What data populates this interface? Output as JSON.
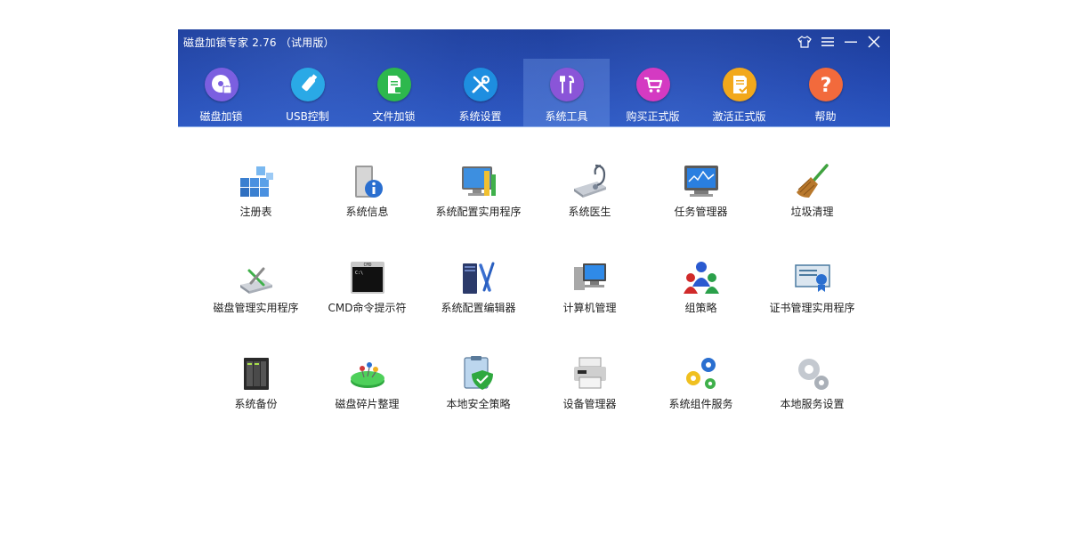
{
  "window": {
    "title": "磁盘加锁专家 2.76 （试用版）"
  },
  "controls": {
    "skin": "shirt-icon",
    "menu": "menu-icon",
    "minimize": "minimize-icon",
    "close": "close-icon"
  },
  "tabs": [
    {
      "label": "磁盘加锁",
      "icon": "disc-lock-icon",
      "color": "#7b5fe0"
    },
    {
      "label": "USB控制",
      "icon": "usb-icon",
      "color": "#2aa9e6"
    },
    {
      "label": "文件加锁",
      "icon": "file-lock-icon",
      "color": "#2db84d"
    },
    {
      "label": "系统设置",
      "icon": "tools-icon",
      "color": "#1e8ee0"
    },
    {
      "label": "系统工具",
      "icon": "toolkit-icon",
      "color": "#8a55d8",
      "active": true
    },
    {
      "label": "购买正式版",
      "icon": "cart-icon",
      "color": "#d43ac2"
    },
    {
      "label": "激活正式版",
      "icon": "activate-icon",
      "color": "#f2a81c"
    },
    {
      "label": "帮助",
      "icon": "help-icon",
      "color": "#f26a3c"
    }
  ],
  "tools": [
    {
      "label": "注册表",
      "icon": "registry-icon"
    },
    {
      "label": "系统信息",
      "icon": "system-info-icon"
    },
    {
      "label": "系统配置实用程序",
      "icon": "system-config-icon"
    },
    {
      "label": "系统医生",
      "icon": "system-doctor-icon"
    },
    {
      "label": "任务管理器",
      "icon": "task-manager-icon"
    },
    {
      "label": "垃圾清理",
      "icon": "broom-icon"
    },
    {
      "label": "磁盘管理实用程序",
      "icon": "disk-management-icon"
    },
    {
      "label": "CMD命令提示符",
      "icon": "cmd-icon"
    },
    {
      "label": "系统配置编辑器",
      "icon": "config-editor-icon"
    },
    {
      "label": "计算机管理",
      "icon": "computer-management-icon"
    },
    {
      "label": "组策略",
      "icon": "group-policy-icon"
    },
    {
      "label": "证书管理实用程序",
      "icon": "certificate-icon"
    },
    {
      "label": "系统备份",
      "icon": "backup-icon"
    },
    {
      "label": "磁盘碎片整理",
      "icon": "defrag-icon"
    },
    {
      "label": "本地安全策略",
      "icon": "security-policy-icon"
    },
    {
      "label": "设备管理器",
      "icon": "device-manager-icon"
    },
    {
      "label": "系统组件服务",
      "icon": "component-services-icon"
    },
    {
      "label": "本地服务设置",
      "icon": "local-services-icon"
    }
  ],
  "colors": {
    "header": "#2348b0",
    "active_tab": "#5b7fd0",
    "text": "#222222"
  }
}
